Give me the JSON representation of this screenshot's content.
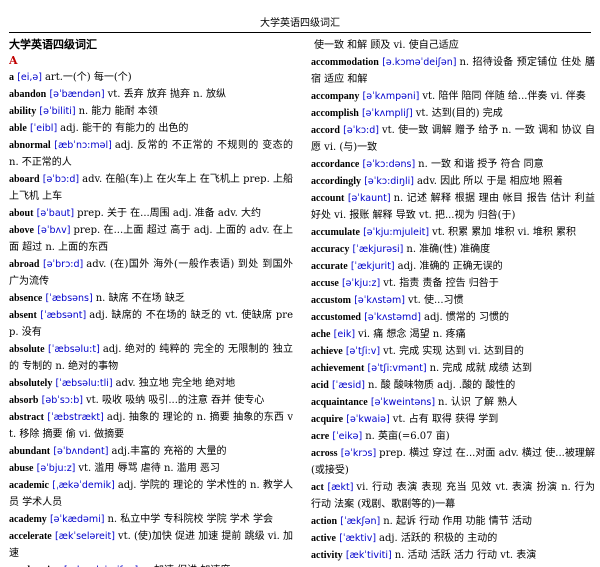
{
  "header": {
    "title": "大学英语四级词汇"
  },
  "document": {
    "title": "大学英语四级词汇",
    "section": "A"
  },
  "left_column": [
    {
      "word": "a",
      "ipa": "[ei,ə]",
      "def": "art.一(个) 每一(个)"
    },
    {
      "word": "abandon",
      "ipa": "[əˈbændən]",
      "def": "vt. 丢弃 放弃 抛弃 n. 放纵"
    },
    {
      "word": "ability",
      "ipa": "[əˈbiliti]",
      "def": "n. 能力 能耐 本领"
    },
    {
      "word": "able",
      "ipa": "[ˈeibl]",
      "def": "adj. 能干的 有能力的 出色的"
    },
    {
      "word": "abnormal",
      "ipa": "[æbˈnɔ:məl]",
      "def": "adj. 反常的 不正常的 不规则的 变态的 n. 不正常的人"
    },
    {
      "word": "aboard",
      "ipa": "[əˈbɔ:d]",
      "def": "adv. 在船(车)上 在火车上 在飞机上 prep. 上船 上飞机 上车"
    },
    {
      "word": "about",
      "ipa": "[əˈbaut]",
      "def": "prep. 关于 在...周围 adj. 准备 adv. 大约"
    },
    {
      "word": "above",
      "ipa": "[əˈbʌv]",
      "def": "prep. 在...上面 超过 高于 adj. 上面的 adv. 在上面 超过 n. 上面的东西"
    },
    {
      "word": "abroad",
      "ipa": "[əˈbrɔ:d]",
      "def": "adv. (在)国外 海外(一般作表语) 到处 到国外 广为流传"
    },
    {
      "word": "absence",
      "ipa": "[ˈæbsəns]",
      "def": "n. 缺席 不在场 缺乏"
    },
    {
      "word": "absent",
      "ipa": "[ˈæbsənt]",
      "def": "adj. 缺席的 不在场的 缺乏的 vt. 使缺席 prep. 没有"
    },
    {
      "word": "absolute",
      "ipa": "[ˈæbsəlu:t]",
      "def": "adj. 绝对的 纯粹的 完全的 无限制的 独立的 专制的 n. 绝对的事物"
    },
    {
      "word": "absolutely",
      "ipa": "[ˈæbsəlu:tli]",
      "def": "adv. 独立地 完全地 绝对地"
    },
    {
      "word": "absorb",
      "ipa": "[əbˈsɔ:b]",
      "def": "vt. 吸收 吸纳 吸引...的注意 吞并 使专心"
    },
    {
      "word": "abstract",
      "ipa": "[ˈæbstrækt]",
      "def": "adj. 抽象的 理论的 n. 摘要 抽象的东西 vt. 移除 摘要 偷 vi. 做摘要"
    },
    {
      "word": "abundant",
      "ipa": "[əˈbʌndənt]",
      "def": "adj.丰富的 充裕的 大量的"
    },
    {
      "word": "abuse",
      "ipa": "[əˈbju:z]",
      "def": "vt. 滥用 辱骂 虐待 n. 滥用 恶习"
    },
    {
      "word": "academic",
      "ipa": "[ˌækəˈdemik]",
      "def": "adj. 学院的 理论的 学术性的 n. 教学人员 学术人员"
    },
    {
      "word": "academy",
      "ipa": "[əˈkædəmi]",
      "def": "n. 私立中学 专科院校 学院 学术 学会"
    },
    {
      "word": "accelerate",
      "ipa": "[ækˈseləreit]",
      "def": "vt. (使)加快 促进 加速 提前 跳级 vi. 加速"
    },
    {
      "word": "acceleration",
      "ipa": "[æk.seləˈreiʃən]",
      "def": "n. 加速 促进 加速度"
    }
  ],
  "right_column": [
    {
      "word": "",
      "ipa": "",
      "def": "使一致 和解 顾及 vi. 使自己适应"
    },
    {
      "word": "accommodation",
      "ipa": "[ə.kɔməˈdeiʃən]",
      "def": "n. 招待设备 预定铺位 住处 膳宿 适应 和解"
    },
    {
      "word": "accompany",
      "ipa": "[əˈkʌmpəni]",
      "def": "vt. 陪伴 陪同 伴随 给...伴奏 vi. 伴奏"
    },
    {
      "word": "accomplish",
      "ipa": "[əˈkʌmpliʃ]",
      "def": "vt. 达到(目的) 完成"
    },
    {
      "word": "accord",
      "ipa": "[əˈkɔ:d]",
      "def": "vt. 使一致 调解 赠予 给予 n. 一致 调和 协议 自愿 vi. (与)一致"
    },
    {
      "word": "accordance",
      "ipa": "[əˈkɔ:dəns]",
      "def": "n. 一致 和谐 授予 符合 同意"
    },
    {
      "word": "accordingly",
      "ipa": "[əˈkɔ:diŋli]",
      "def": "adv. 因此 所以 于是 相应地 照着"
    },
    {
      "word": "account",
      "ipa": "[əˈkaunt]",
      "def": "n. 记述 解释 根据 理由 帐目 报告 估计 利益 好处 vi. 报账 解释 导致 vt. 把...视为 归咎(于)"
    },
    {
      "word": "accumulate",
      "ipa": "[əˈkju:mjuleit]",
      "def": "vt. 积累 累加 堆积 vi. 堆积 累积"
    },
    {
      "word": "accuracy",
      "ipa": "[ˈækjurəsi]",
      "def": "n. 准确(性) 准确度"
    },
    {
      "word": "accurate",
      "ipa": "[ˈækjurit]",
      "def": "adj. 准确的 正确无误的"
    },
    {
      "word": "accuse",
      "ipa": "[əˈkju:z]",
      "def": "vt. 指责 责备 控告 归咎于"
    },
    {
      "word": "accustom",
      "ipa": "[əˈkʌstəm]",
      "def": "vt. 使...习惯"
    },
    {
      "word": "accustomed",
      "ipa": "[əˈkʌstəmd]",
      "def": "adj. 惯常的 习惯的"
    },
    {
      "word": "ache",
      "ipa": "[eik]",
      "def": "vi. 痛 想念 渴望 n. 疼痛"
    },
    {
      "word": "achieve",
      "ipa": "[əˈtʃi:v]",
      "def": "vt. 完成 实现 达到 vi. 达到目的"
    },
    {
      "word": "achievement",
      "ipa": "[əˈtʃi:vmənt]",
      "def": "n. 完成 成就 成绩 达到"
    },
    {
      "word": "acid",
      "ipa": "[ˈæsid]",
      "def": "n. 酸 酸味物质 adj. .酸的 酸性的"
    },
    {
      "word": "acquaintance",
      "ipa": "[əˈkweintəns]",
      "def": "n. 认识 了解 熟人"
    },
    {
      "word": "acquire",
      "ipa": "[əˈkwaiə]",
      "def": "vt. 占有 取得 获得 学到"
    },
    {
      "word": "acre",
      "ipa": "[ˈeikə]",
      "def": "n. 英亩(=6.07 亩)"
    },
    {
      "word": "across",
      "ipa": "[əˈkrɔs]",
      "def": "prep. 横过 穿过 在...对面 adv. 横过 使...被理解(或接受)"
    },
    {
      "word": "act",
      "ipa": "[ækt]",
      "def": "vi. 行动 表演 表现 充当 见效 vt. 表演 扮演 n. 行为 行动 法案 (戏剧、歌剧等的)一幕"
    },
    {
      "word": "action",
      "ipa": "[ˈækʃən]",
      "def": "n. 起诉 行动 作用 功能 情节 活动"
    },
    {
      "word": "active",
      "ipa": "[ˈæktiv]",
      "def": "adj. 活跃的 积极的 主动的"
    },
    {
      "word": "activity",
      "ipa": "[ækˈtiviti]",
      "def": "n. 活动 活跃 活力 行动 vt. 表演"
    }
  ]
}
